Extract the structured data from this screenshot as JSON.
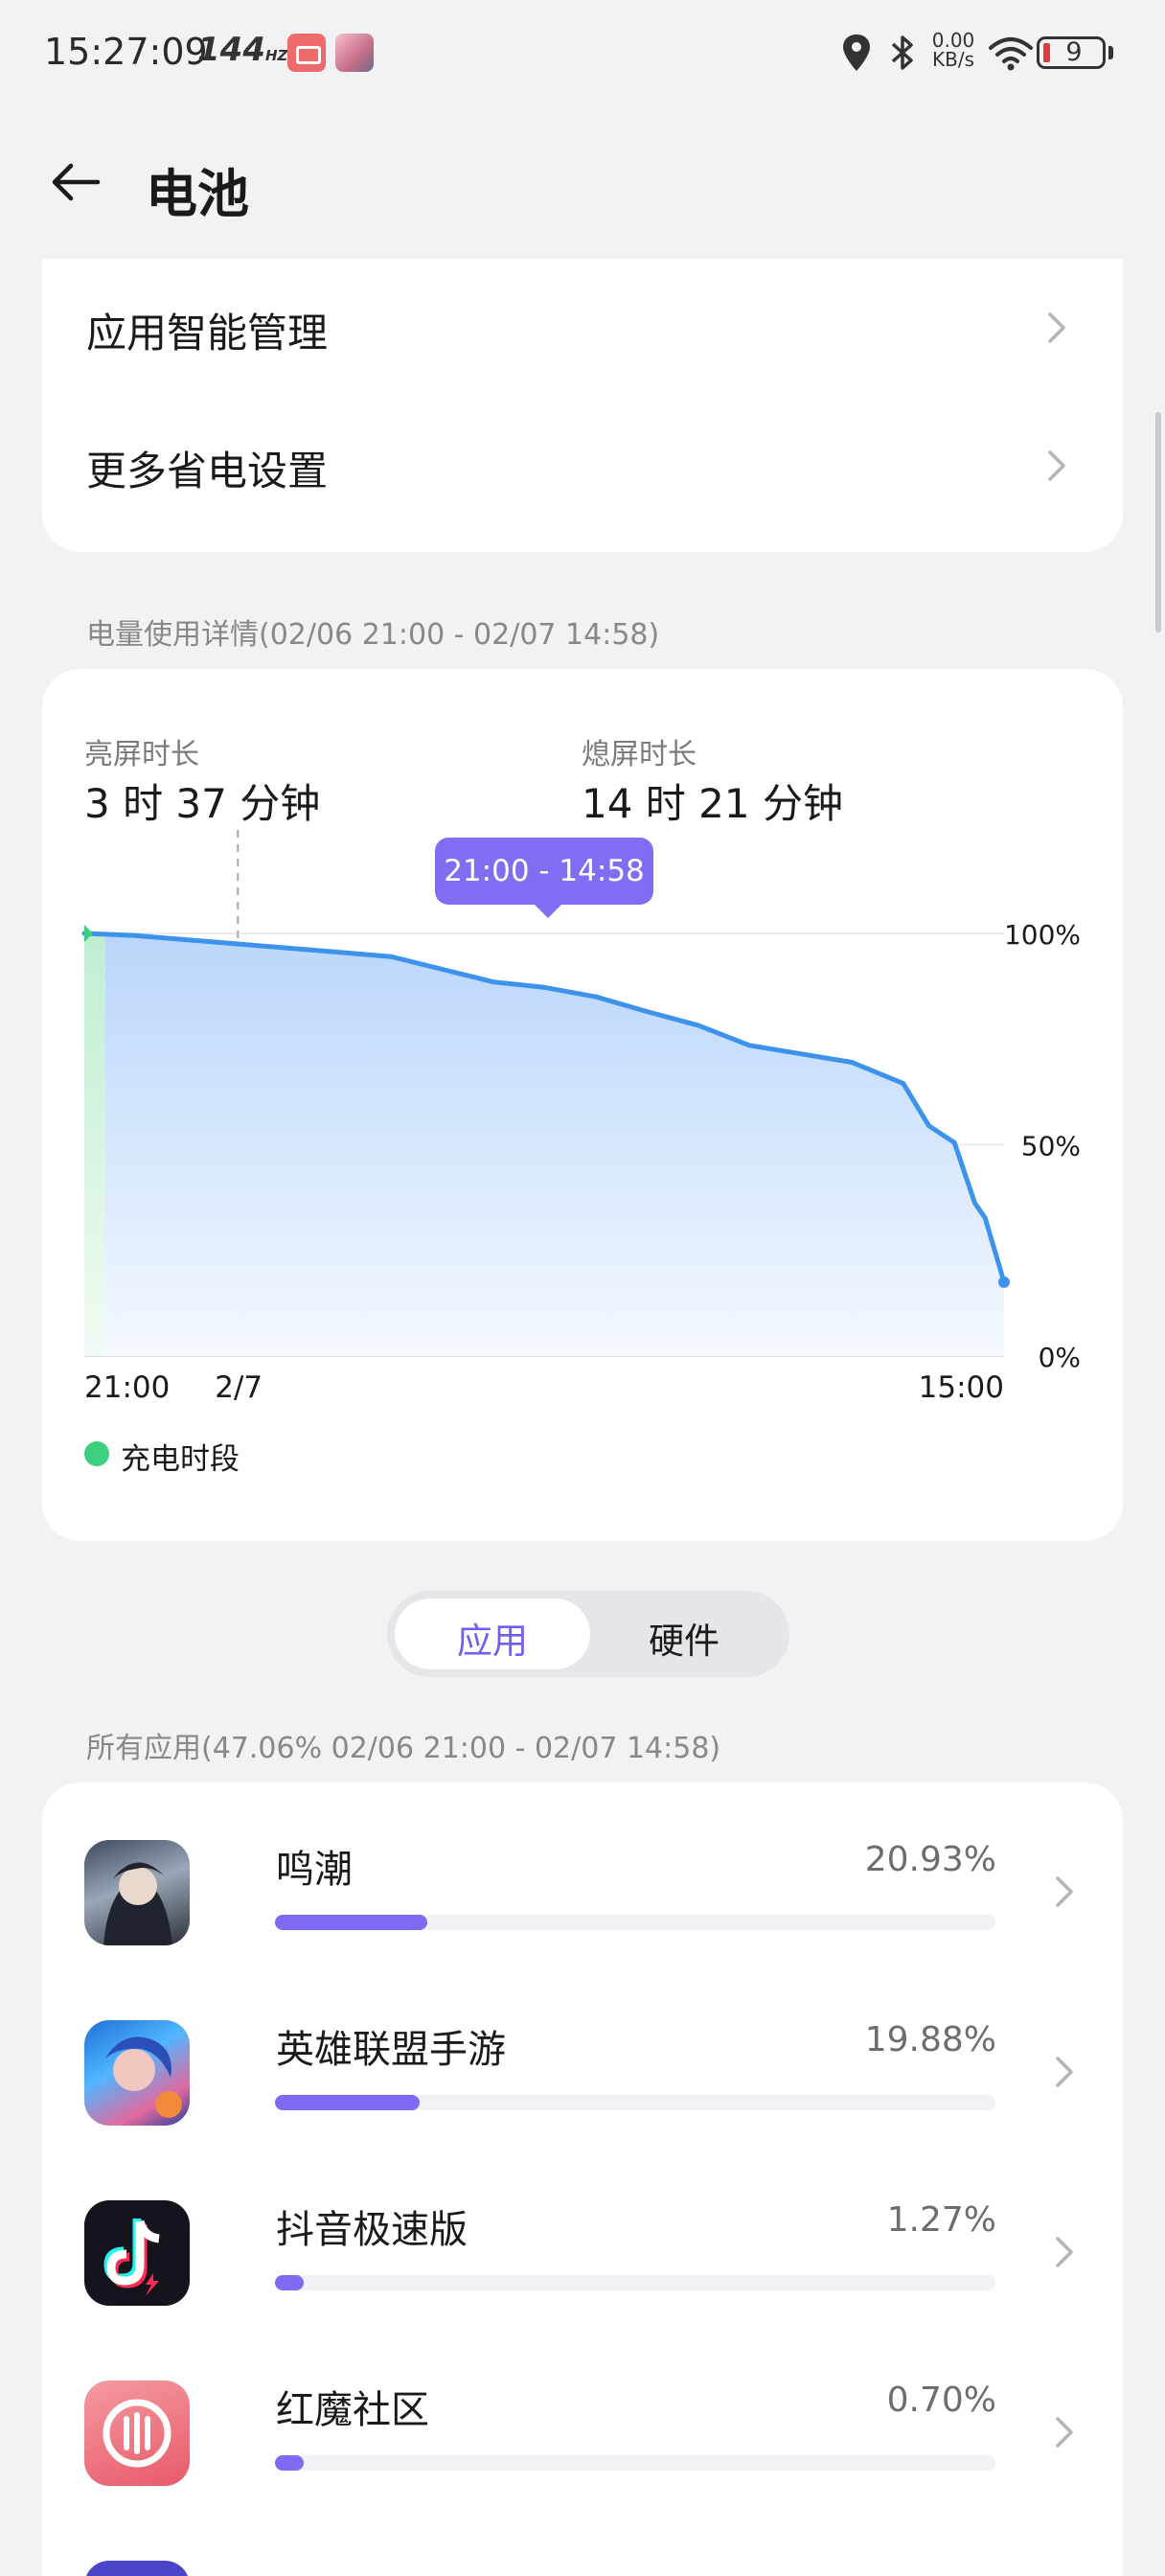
{
  "status_bar": {
    "time": "15:27:09",
    "refresh_rate": "144",
    "refresh_unit": "HZ",
    "net_speed_value": "0.00",
    "net_speed_unit": "KB/s",
    "battery_level": "9",
    "icons": [
      "battery-saver-app-icon",
      "avatar-app-icon",
      "location-icon",
      "bluetooth-icon",
      "wifi-icon",
      "battery-icon"
    ]
  },
  "header": {
    "title": "电池"
  },
  "settings": {
    "items": [
      {
        "label": "应用智能管理"
      },
      {
        "label": "更多省电设置"
      }
    ]
  },
  "usage": {
    "caption": "电量使用详情(02/06 21:00 - 02/07 14:58)",
    "screen_on_label": "亮屏时长",
    "screen_on_value": "3 时 37 分钟",
    "screen_off_label": "熄屏时长",
    "screen_off_value": "14 时 21 分钟",
    "tooltip": "21:00 - 14:58",
    "legend_charging": "充电时段"
  },
  "chart_data": {
    "type": "area",
    "x_ticks": [
      "21:00",
      "2/7",
      "15:00"
    ],
    "y_ticks": [
      "100%",
      "50%",
      "0%"
    ],
    "ylim": [
      0,
      100
    ],
    "x_hours": [
      0,
      1,
      2,
      3,
      4,
      5,
      6,
      7,
      8,
      9,
      10,
      11,
      12,
      13,
      14,
      15,
      16,
      16.5,
      17,
      17.4,
      17.6,
      17.97
    ],
    "x_hours_origin": "21:00",
    "series": [
      {
        "values": [
          100,
          99.5,
          98.5,
          97.5,
          96.5,
          95.5,
          94.5,
          91.5,
          88.5,
          87.2,
          85.0,
          81.5,
          78.2,
          73.5,
          71.5,
          69.5,
          64.5,
          54.5,
          50.5,
          36.2,
          32.7,
          17.5
        ]
      }
    ],
    "charging_period": [
      "21:00",
      "21:05"
    ],
    "dashed_marker": "2/7",
    "grid": true,
    "colors": {
      "line": "#3d93eb",
      "fill": "#c3dcfc",
      "charging": "#3ecf7e"
    }
  },
  "segmented": {
    "apps": "应用",
    "hardware": "硬件",
    "active": "apps"
  },
  "apps": {
    "caption": "所有应用(47.06% 02/06 21:00 - 02/07 14:58)",
    "items": [
      {
        "name": "鸣潮",
        "percent": "20.93%",
        "value": 20.93,
        "icon": "mingchao-app-icon"
      },
      {
        "name": "英雄联盟手游",
        "percent": "19.88%",
        "value": 19.88,
        "icon": "lol-app-icon"
      },
      {
        "name": "抖音极速版",
        "percent": "1.27%",
        "value": 1.27,
        "icon": "douyin-app-icon"
      },
      {
        "name": "红魔社区",
        "percent": "0.70%",
        "value": 0.7,
        "icon": "redmagic-app-icon"
      }
    ]
  },
  "colors": {
    "accent": "#7b6cf3",
    "background": "#f2f2f5",
    "card": "#ffffff"
  }
}
